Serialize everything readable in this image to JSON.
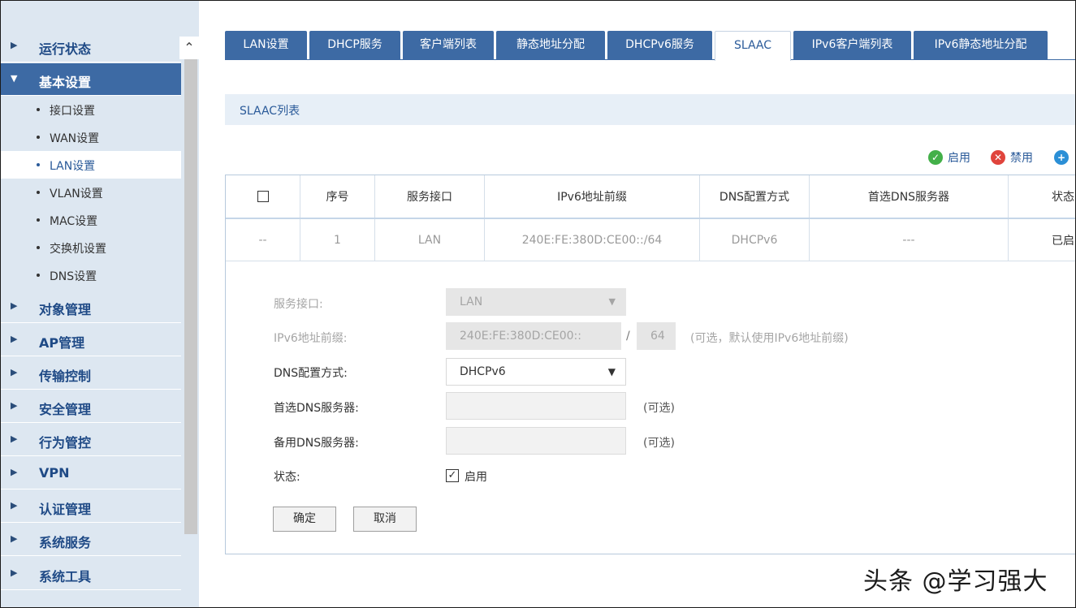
{
  "sidebar": {
    "scroll_up_icon": "chevron-up-icon",
    "items": [
      {
        "label": "运行状态",
        "expanded": false
      },
      {
        "label": "基本设置",
        "expanded": true
      }
    ],
    "sub_items": [
      {
        "label": "接口设置",
        "active": false
      },
      {
        "label": "WAN设置",
        "active": false
      },
      {
        "label": "LAN设置",
        "active": true
      },
      {
        "label": "VLAN设置",
        "active": false
      },
      {
        "label": "MAC设置",
        "active": false
      },
      {
        "label": "交换机设置",
        "active": false
      },
      {
        "label": "DNS设置",
        "active": false
      }
    ],
    "lower_items": [
      {
        "label": "对象管理"
      },
      {
        "label": "AP管理"
      },
      {
        "label": "传输控制"
      },
      {
        "label": "安全管理"
      },
      {
        "label": "行为管控"
      },
      {
        "label": "VPN"
      },
      {
        "label": "认证管理"
      },
      {
        "label": "系统服务"
      },
      {
        "label": "系统工具"
      }
    ]
  },
  "tabs": [
    {
      "label": "LAN设置",
      "active": false
    },
    {
      "label": "DHCP服务",
      "active": false
    },
    {
      "label": "客户端列表",
      "active": false
    },
    {
      "label": "静态地址分配",
      "active": false
    },
    {
      "label": "DHCPv6服务",
      "active": false
    },
    {
      "label": "SLAAC",
      "active": true
    },
    {
      "label": "IPv6客户端列表",
      "active": false
    },
    {
      "label": "IPv6静态地址分配",
      "active": false
    }
  ],
  "section": {
    "title": "SLAAC列表"
  },
  "toolbar": {
    "enable_label": "启用",
    "disable_label": "禁用",
    "enable_icon": "check-circle-icon",
    "disable_icon": "x-circle-icon",
    "add_icon": "plus-circle-icon"
  },
  "table": {
    "headers": [
      "",
      "序号",
      "服务接口",
      "IPv6地址前缀",
      "DNS配置方式",
      "首选DNS服务器",
      "状态"
    ],
    "rows": [
      [
        "--",
        "1",
        "LAN",
        "240E:FE:380D:CE00::/64",
        "DHCPv6",
        "---",
        "已启"
      ]
    ]
  },
  "form": {
    "interface_label": "服务接口:",
    "interface_value": "LAN",
    "prefix_label": "IPv6地址前缀:",
    "prefix_value": "240E:FE:380D:CE00::",
    "prefix_separator": "/",
    "prefix_len_value": "64",
    "prefix_note": "(可选，默认使用IPv6地址前缀)",
    "dns_mode_label": "DNS配置方式:",
    "dns_mode_value": "DHCPv6",
    "primary_dns_label": "首选DNS服务器:",
    "primary_dns_value": "",
    "primary_dns_note": "(可选)",
    "secondary_dns_label": "备用DNS服务器:",
    "secondary_dns_value": "",
    "secondary_dns_note": "(可选)",
    "status_label": "状态:",
    "status_checkbox_label": "启用",
    "status_checked": true,
    "confirm_label": "确定",
    "cancel_label": "取消"
  },
  "watermark": "头条 @学习强大"
}
